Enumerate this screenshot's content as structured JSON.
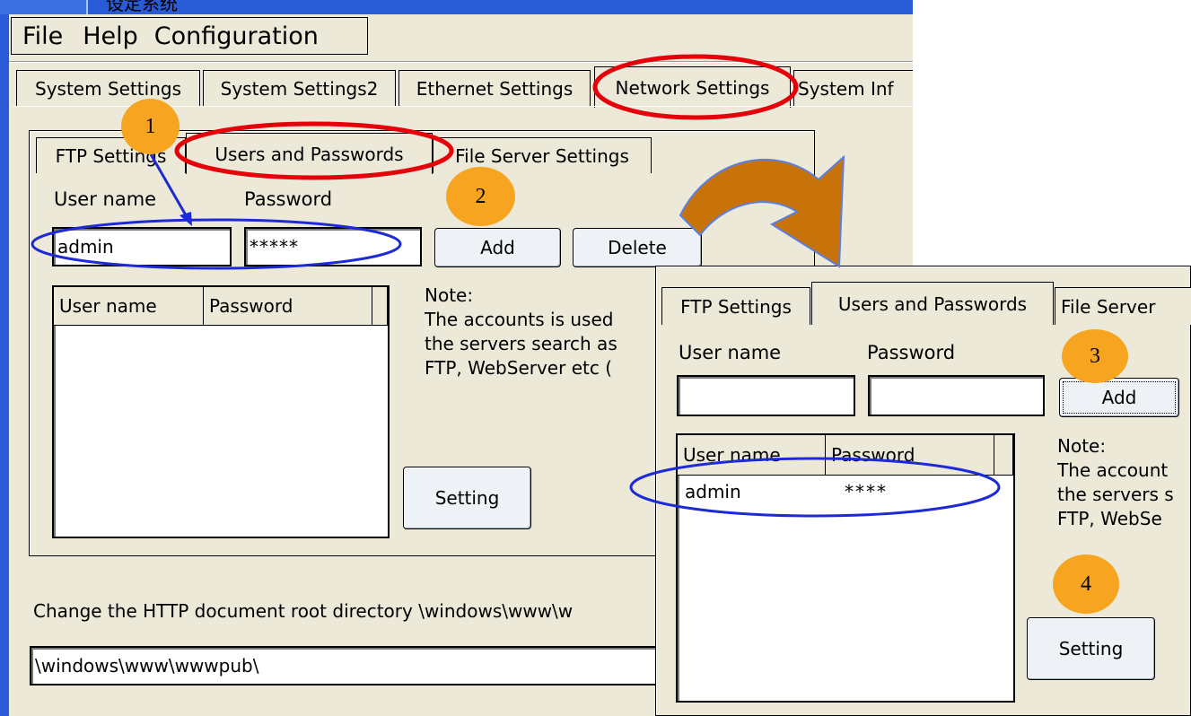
{
  "window": {
    "title": "设定系统",
    "icon": "app-icon"
  },
  "menu": {
    "items": [
      "File",
      "Help",
      "Configuration"
    ]
  },
  "main_tabs": [
    "System Settings",
    "System Settings2",
    "Ethernet Settings",
    "Network Settings",
    "System Inf"
  ],
  "sub_tabs": [
    "FTP Settings",
    "Users and Passwords",
    "File Server Settings"
  ],
  "form": {
    "username_label": "User name",
    "password_label": "Password",
    "username_value": "admin",
    "password_value": "*****",
    "add_label": "Add",
    "delete_label": "Delete",
    "setting_label": "Setting"
  },
  "list": {
    "col1": "User name",
    "col2": "Password"
  },
  "note": {
    "line0": "Note:",
    "line1": "The accounts is used",
    "line2": "the servers search as",
    "line3": "FTP, WebServer etc ("
  },
  "http": {
    "label": "Change the HTTP document root directory \\windows\\www\\w",
    "value": "\\windows\\www\\wwwpub\\"
  },
  "overlay": {
    "tabs": [
      "FTP Settings",
      "Users and Passwords",
      "File Server"
    ],
    "username_label": "User name",
    "password_label": "Password",
    "add_label": "Add",
    "list_col1": "User name",
    "list_col2": "Password",
    "row_user": "admin",
    "row_pass": "****",
    "note_line0": "Note:",
    "note_line1": "The account",
    "note_line2": "the servers s",
    "note_line3": "FTP, WebSe",
    "setting_label": "Setting"
  },
  "steps": [
    "1",
    "2",
    "3",
    "4"
  ],
  "colors": {
    "window_bg": "#ece9d8",
    "title_blue": "#2a5bd7",
    "step_orange": "#f7a520",
    "arrow_brown": "#c8730a",
    "annot_red": "#e5000a",
    "annot_blue": "#1d2ad6"
  }
}
